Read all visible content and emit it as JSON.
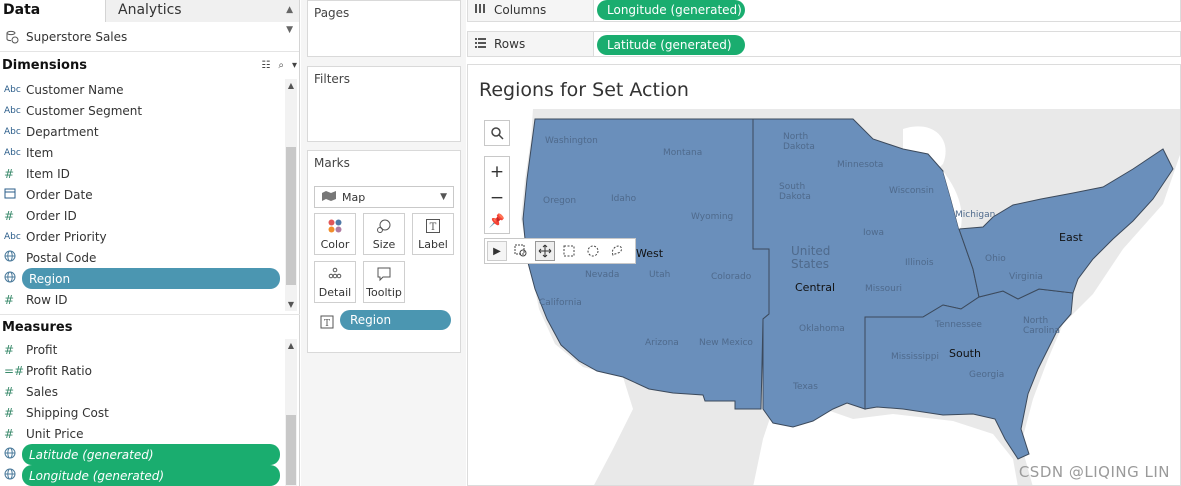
{
  "left_pane": {
    "tabs": {
      "data": "Data",
      "analytics": "Analytics"
    },
    "datasource": "Superstore Sales",
    "dimensions_header": "Dimensions",
    "dimensions": [
      {
        "icon": "Abc",
        "label": "Customer Name"
      },
      {
        "icon": "Abc",
        "label": "Customer Segment"
      },
      {
        "icon": "Abc",
        "label": "Department"
      },
      {
        "icon": "Abc",
        "label": "Item"
      },
      {
        "icon": "#",
        "label": "Item ID"
      },
      {
        "icon": "calendar",
        "label": "Order Date"
      },
      {
        "icon": "#",
        "label": "Order ID"
      },
      {
        "icon": "Abc",
        "label": "Order Priority"
      },
      {
        "icon": "globe",
        "label": "Postal Code"
      },
      {
        "icon": "globe",
        "label": "Region",
        "selected": true
      },
      {
        "icon": "#",
        "label": "Row ID"
      }
    ],
    "measures_header": "Measures",
    "measures": [
      {
        "icon": "#",
        "label": "Profit"
      },
      {
        "icon": "=#",
        "label": "Profit Ratio"
      },
      {
        "icon": "#",
        "label": "Sales"
      },
      {
        "icon": "#",
        "label": "Shipping Cost"
      },
      {
        "icon": "#",
        "label": "Unit Price"
      },
      {
        "icon": "globe",
        "label": "Latitude (generated)",
        "pill": true
      },
      {
        "icon": "globe",
        "label": "Longitude (generated)",
        "pill": true
      }
    ]
  },
  "shelves": {
    "pages": "Pages",
    "filters": "Filters",
    "marks": "Marks",
    "mark_type": "Map",
    "mark_buttons": {
      "color": "Color",
      "size": "Size",
      "label": "Label",
      "detail": "Detail",
      "tooltip": "Tooltip"
    },
    "marks_pill": "Region",
    "columns_label": "Columns",
    "columns_pill": "Longitude (generated)",
    "rows_label": "Rows",
    "rows_pill": "Latitude (generated)"
  },
  "viz": {
    "title": "Regions for Set Action",
    "region_labels": {
      "west": "West",
      "central": "Central",
      "south": "South",
      "east": "East"
    },
    "basemap_labels": {
      "washington": "Washington",
      "montana": "Montana",
      "oregon": "Oregon",
      "idaho": "Idaho",
      "wyoming": "Wyoming",
      "nevada": "Nevada",
      "utah": "Utah",
      "colorado": "Colorado",
      "california": "California",
      "arizona": "Arizona",
      "new_mexico": "New Mexico",
      "north_dakota": "North\nDakota",
      "south_dakota": "South\nDakota",
      "minnesota": "Minnesota",
      "wisconsin": "Wisconsin",
      "iowa": "Iowa",
      "illinois": "Illinois",
      "missouri": "Missouri",
      "oklahoma": "Oklahoma",
      "texas": "Texas",
      "united_states": "United\nStates",
      "michigan": "Michigan",
      "ohio": "Ohio",
      "tennessee": "Tennessee",
      "mississippi": "Mississippi",
      "georgia": "Georgia",
      "north_carolina": "North\nCarolina",
      "virginia": "Virginia"
    },
    "colors": {
      "region_fill": "#6a8fbb",
      "region_border": "#3c4a5c",
      "land": "#eaeaea",
      "water": "#ffffff"
    }
  },
  "watermark": "CSDN @LIQING LIN"
}
